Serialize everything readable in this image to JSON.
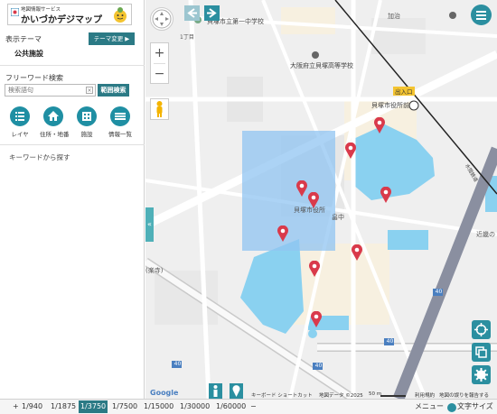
{
  "logo": {
    "subtitle": "地図情報サービス",
    "title": "かいづかデジマップ"
  },
  "sidebar": {
    "theme_label": "表示テーマ",
    "theme_change": "テーマ変更 ▶",
    "theme_value": "公共施設",
    "search_label": "フリーワード検索",
    "search_placeholder": "検索語句",
    "search_clear": "×",
    "range_search": "範囲検索",
    "tools": [
      {
        "label": "レイヤ",
        "icon": "list-icon"
      },
      {
        "label": "住所・地番",
        "icon": "home-icon"
      },
      {
        "label": "施設",
        "icon": "building-icon"
      },
      {
        "label": "情報一覧",
        "icon": "table-icon"
      }
    ],
    "keyword_hint": "キーワードから探す",
    "collapse": "«"
  },
  "map": {
    "labels": {
      "school1": "貝塚市立第一中学校",
      "school2": "大阪府立貝塚高等学校",
      "station_exit": "出入口",
      "station": "貝塚市役所前",
      "kaji": "加治",
      "chome": "1丁目",
      "center": "貝塚市役所",
      "naka": "畠中",
      "kinki": "近畿の",
      "rakuji": "(楽寺)",
      "road_right": "水間鉄道"
    },
    "route_numbers": [
      "40",
      "40",
      "40",
      "40"
    ],
    "footer": {
      "google": "Google",
      "shortcut": "キーボード ショートカット",
      "map_data": "地図データ ©2025",
      "scale_text": "50 m",
      "terms": "利用規約",
      "report": "地図の誤りを報告する"
    },
    "zoom_in": "+",
    "zoom_out": "−"
  },
  "bottombar": {
    "plus": "+",
    "minus": "−",
    "scales": [
      "1/940",
      "1/1875",
      "1/3750",
      "1/7500",
      "1/15000",
      "1/30000",
      "1/60000"
    ],
    "active_scale": "1/3750",
    "menu": "メニュー",
    "text_size": "文字サイズ"
  },
  "colors": {
    "accent": "#2b7a85",
    "button_teal": "#1f8fa3",
    "selection": "#90c4f2",
    "water": "#8ad1f0",
    "pin": "#d93a4b"
  }
}
